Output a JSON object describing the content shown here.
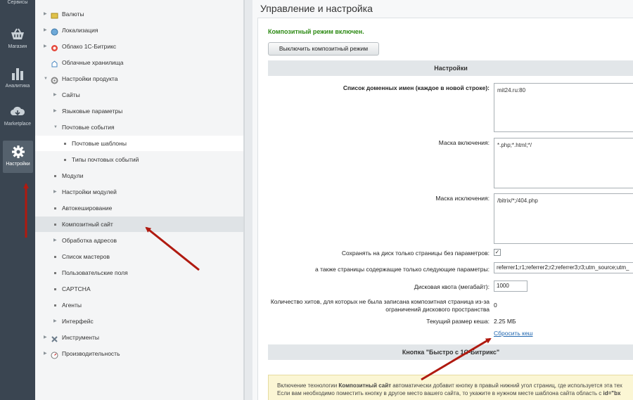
{
  "rail": {
    "items": [
      {
        "label": "Сервисы",
        "icon": "services-icon"
      },
      {
        "label": "Магазин",
        "icon": "basket-icon"
      },
      {
        "label": "Аналитика",
        "icon": "bar-chart-icon"
      },
      {
        "label": "Marketplace",
        "icon": "cloud-download-icon"
      },
      {
        "label": "Настройки",
        "icon": "gear-icon",
        "active": true
      }
    ]
  },
  "tree": {
    "items": [
      {
        "label": "Валюты"
      },
      {
        "label": "Локализация"
      },
      {
        "label": "Облако 1С-Битрикс"
      },
      {
        "label": "Облачные хранилища"
      },
      {
        "label": "Настройки продукта"
      },
      {
        "label": "Сайты"
      },
      {
        "label": "Языковые параметры"
      },
      {
        "label": "Почтовые события"
      },
      {
        "label": "Почтовые шаблоны"
      },
      {
        "label": "Типы почтовых событий"
      },
      {
        "label": "Модули"
      },
      {
        "label": "Настройки модулей"
      },
      {
        "label": "Автокеширование"
      },
      {
        "label": "Композитный сайт"
      },
      {
        "label": "Обработка адресов"
      },
      {
        "label": "Список мастеров"
      },
      {
        "label": "Пользовательские поля"
      },
      {
        "label": "CAPTCHA"
      },
      {
        "label": "Агенты"
      },
      {
        "label": "Интерфейс"
      },
      {
        "label": "Инструменты"
      },
      {
        "label": "Производительность"
      }
    ]
  },
  "main": {
    "title": "Управление и настройка",
    "status_message": "Композитный режим включен.",
    "disable_button": "Выключить композитный режим",
    "settings_header": "Настройки",
    "domains_label": "Список доменных имен (каждое в новой строке):",
    "domains_value": "mit24.ru:80",
    "include_mask_label": "Маска включения:",
    "include_mask_value": "*.php;*.html;*/",
    "exclude_mask_label": "Маска исключения:",
    "exclude_mask_value": "/bitrix/*;/404.php",
    "save_no_params_label": "Сохранять на диск только страницы без параметров:",
    "save_no_params_checked": true,
    "params_label": "а также страницы содержащие только следующие параметры:",
    "params_value": "referrer1;r1;referrer2;r2;referrer3;r3;utm_source;utm_",
    "quota_label": "Дисковая квота (мегабайт):",
    "quota_value": "1000",
    "hits_label_1": "Количество хитов, для которых не была записана композитная страница из-за",
    "hits_label_2": "ограничений дискового пространства",
    "hits_value": "0",
    "cache_size_label": "Текущий размер кеша:",
    "cache_size_value": "2.25 МБ",
    "reset_cache_link": "Сбросить кеш",
    "button_section_header": "Кнопка \"Быстро с 1С-Битрикс\"",
    "note_line1_a": "Включение технологии ",
    "note_line1_b": "Композитный сайт",
    "note_line1_c": " автоматически добавит кнопку в правый нижний угол страниц, где используется эта тех",
    "note_line2_a": "Если вам необходимо поместить кнопку в другое место вашего сайта, то укажите в нужном месте шаблона сайта область с ",
    "note_line2_b": "id=\"bx",
    "colors": {
      "accent_green": "#2d8a14",
      "link_blue": "#2067b0",
      "arrow_red": "#b01a10",
      "rail_bg": "#3a4551"
    }
  }
}
